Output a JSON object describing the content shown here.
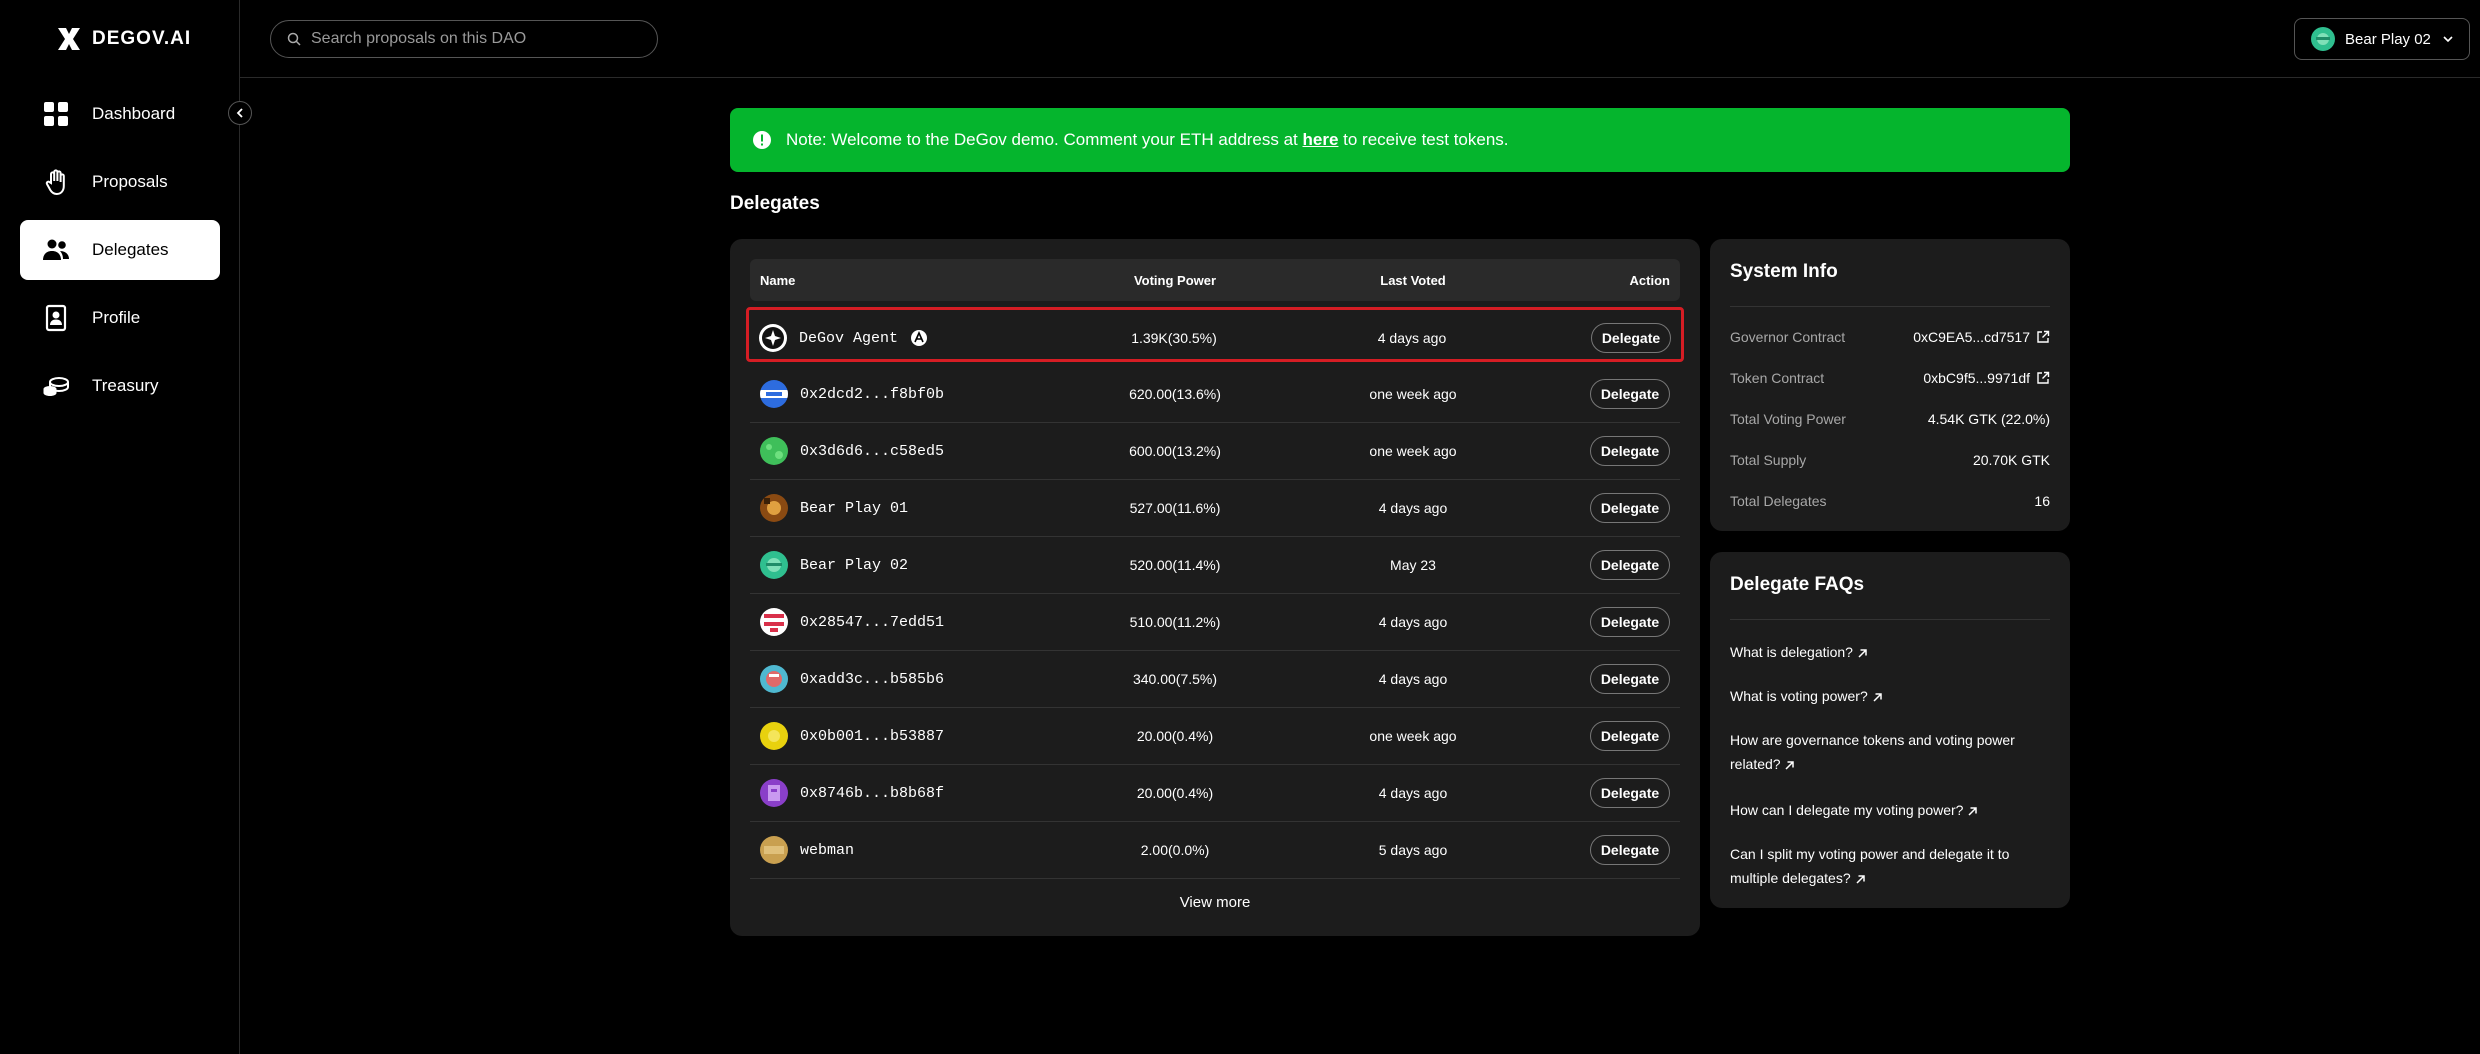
{
  "app": {
    "logo_text": "DEGOV.AI"
  },
  "sidebar": {
    "items": [
      {
        "label": "Dashboard",
        "icon": "dashboard-icon",
        "active": false
      },
      {
        "label": "Proposals",
        "icon": "hand-icon",
        "active": false
      },
      {
        "label": "Delegates",
        "icon": "users-icon",
        "active": true
      },
      {
        "label": "Profile",
        "icon": "profile-icon",
        "active": false
      },
      {
        "label": "Treasury",
        "icon": "coins-icon",
        "active": false
      }
    ]
  },
  "topbar": {
    "search_placeholder": "Search proposals on this DAO",
    "account_name": "Bear Play 02"
  },
  "note": {
    "prefix": "Note: Welcome to the DeGov demo. Comment your ETH address at ",
    "link": "here",
    "suffix": " to receive test tokens.",
    "color": "#05b52d"
  },
  "page": {
    "title": "Delegates"
  },
  "table": {
    "headers": {
      "name": "Name",
      "voting_power": "Voting Power",
      "last_voted": "Last Voted",
      "action": "Action"
    },
    "rows": [
      {
        "name": "DeGov Agent",
        "voting_power": "1.39K(30.5%)",
        "last_voted": "4 days ago",
        "action": "Delegate",
        "agent_badge": true,
        "highlighted": true
      },
      {
        "name": "0x2dcd2...f8bf0b",
        "voting_power": "620.00(13.6%)",
        "last_voted": "one week ago",
        "action": "Delegate"
      },
      {
        "name": "0x3d6d6...c58ed5",
        "voting_power": "600.00(13.2%)",
        "last_voted": "one week ago",
        "action": "Delegate"
      },
      {
        "name": "Bear Play 01",
        "voting_power": "527.00(11.6%)",
        "last_voted": "4 days ago",
        "action": "Delegate"
      },
      {
        "name": "Bear Play 02",
        "voting_power": "520.00(11.4%)",
        "last_voted": "May 23",
        "action": "Delegate"
      },
      {
        "name": "0x28547...7edd51",
        "voting_power": "510.00(11.2%)",
        "last_voted": "4 days ago",
        "action": "Delegate"
      },
      {
        "name": "0xadd3c...b585b6",
        "voting_power": "340.00(7.5%)",
        "last_voted": "4 days ago",
        "action": "Delegate"
      },
      {
        "name": "0x0b001...b53887",
        "voting_power": "20.00(0.4%)",
        "last_voted": "one week ago",
        "action": "Delegate"
      },
      {
        "name": "0x8746b...b8b68f",
        "voting_power": "20.00(0.4%)",
        "last_voted": "4 days ago",
        "action": "Delegate"
      },
      {
        "name": "webman",
        "voting_power": "2.00(0.0%)",
        "last_voted": "5 days ago",
        "action": "Delegate"
      }
    ],
    "view_more": "View more"
  },
  "system_info": {
    "title": "System Info",
    "rows": [
      {
        "label": "Governor Contract",
        "value": "0xC9EA5...cd7517",
        "external_link": true
      },
      {
        "label": "Token Contract",
        "value": "0xbC9f5...9971df",
        "external_link": true
      },
      {
        "label": "Total Voting Power",
        "value": "4.54K GTK (22.0%)"
      },
      {
        "label": "Total Supply",
        "value": "20.70K GTK"
      },
      {
        "label": "Total Delegates",
        "value": "16"
      }
    ]
  },
  "faqs": {
    "title": "Delegate FAQs",
    "items": [
      "What is delegation?",
      "What is voting power?",
      "How are governance tokens and voting power related?",
      "How can I delegate my voting power?",
      "Can I split my voting power and delegate it to multiple delegates?"
    ]
  }
}
